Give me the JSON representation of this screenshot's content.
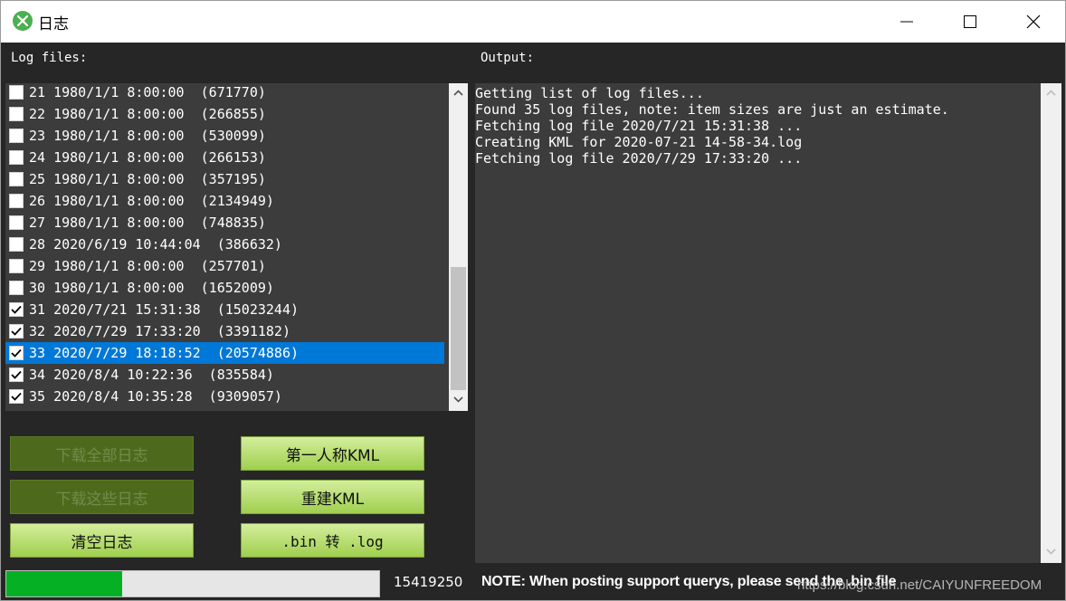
{
  "window": {
    "title": "日志",
    "icon": "app-logo-icon",
    "controls": [
      "minimize-icon",
      "maximize-icon",
      "close-icon"
    ]
  },
  "labels": {
    "log_files": "Log files:",
    "output": "Output:"
  },
  "log_list": {
    "items": [
      {
        "text": "21 1980/1/1 8:00:00  (671770)",
        "checked": false,
        "selected": false
      },
      {
        "text": "22 1980/1/1 8:00:00  (266855)",
        "checked": false,
        "selected": false
      },
      {
        "text": "23 1980/1/1 8:00:00  (530099)",
        "checked": false,
        "selected": false
      },
      {
        "text": "24 1980/1/1 8:00:00  (266153)",
        "checked": false,
        "selected": false
      },
      {
        "text": "25 1980/1/1 8:00:00  (357195)",
        "checked": false,
        "selected": false
      },
      {
        "text": "26 1980/1/1 8:00:00  (2134949)",
        "checked": false,
        "selected": false
      },
      {
        "text": "27 1980/1/1 8:00:00  (748835)",
        "checked": false,
        "selected": false
      },
      {
        "text": "28 2020/6/19 10:44:04  (386632)",
        "checked": false,
        "selected": false
      },
      {
        "text": "29 1980/1/1 8:00:00  (257701)",
        "checked": false,
        "selected": false
      },
      {
        "text": "30 1980/1/1 8:00:00  (1652009)",
        "checked": false,
        "selected": false
      },
      {
        "text": "31 2020/7/21 15:31:38  (15023244)",
        "checked": true,
        "selected": false
      },
      {
        "text": "32 2020/7/29 17:33:20  (3391182)",
        "checked": true,
        "selected": false
      },
      {
        "text": "33 2020/7/29 18:18:52  (20574886)",
        "checked": true,
        "selected": true
      },
      {
        "text": "34 2020/8/4 10:22:36  (835584)",
        "checked": true,
        "selected": false
      },
      {
        "text": "35 2020/8/4 10:35:28  (9309057)",
        "checked": true,
        "selected": false
      }
    ]
  },
  "output": {
    "lines": [
      "Getting list of log files...",
      "Found 35 log files, note: item sizes are just an estimate.",
      "Fetching log file 2020/7/21 15:31:38 ...",
      "Creating KML for 2020-07-21 14-58-34.log",
      "Fetching log file 2020/7/29 17:33:20 ..."
    ]
  },
  "buttons": {
    "download_all": "下载全部日志",
    "download_these": "下载这些日志",
    "clear_logs": "清空日志",
    "first_person_kml": "第一人称KML",
    "rebuild_kml": "重建KML",
    "bin_to_log": ".bin 转 .log"
  },
  "progress": {
    "fraction": 0.31,
    "value_text": "15419250"
  },
  "note": "NOTE: When posting support querys, please send the .bin file",
  "watermark": "https://blog.csdn.net/CAIYUNFREEDOM",
  "colors": {
    "background": "#262626",
    "panel": "#3c3c3c",
    "selection": "#0078d7",
    "progress": "#06b025",
    "button_enabled": "#b7df72",
    "button_disabled": "#4d6a1c"
  }
}
